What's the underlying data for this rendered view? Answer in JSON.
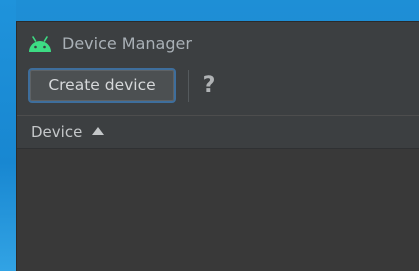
{
  "window": {
    "title": "Device Manager"
  },
  "toolbar": {
    "create_label": "Create device",
    "help_glyph": "?"
  },
  "table": {
    "columns": [
      {
        "label": "Device",
        "sort": "ascending"
      }
    ],
    "rows": []
  },
  "icons": {
    "app": "android-icon",
    "help": "help-icon",
    "sort": "sort-ascending-icon"
  },
  "colors": {
    "android_green": "#3ddc84",
    "button_focus_border": "#3e6e9c",
    "window_bg": "#3c3f41",
    "desktop_bg": "#1e8fd6"
  }
}
